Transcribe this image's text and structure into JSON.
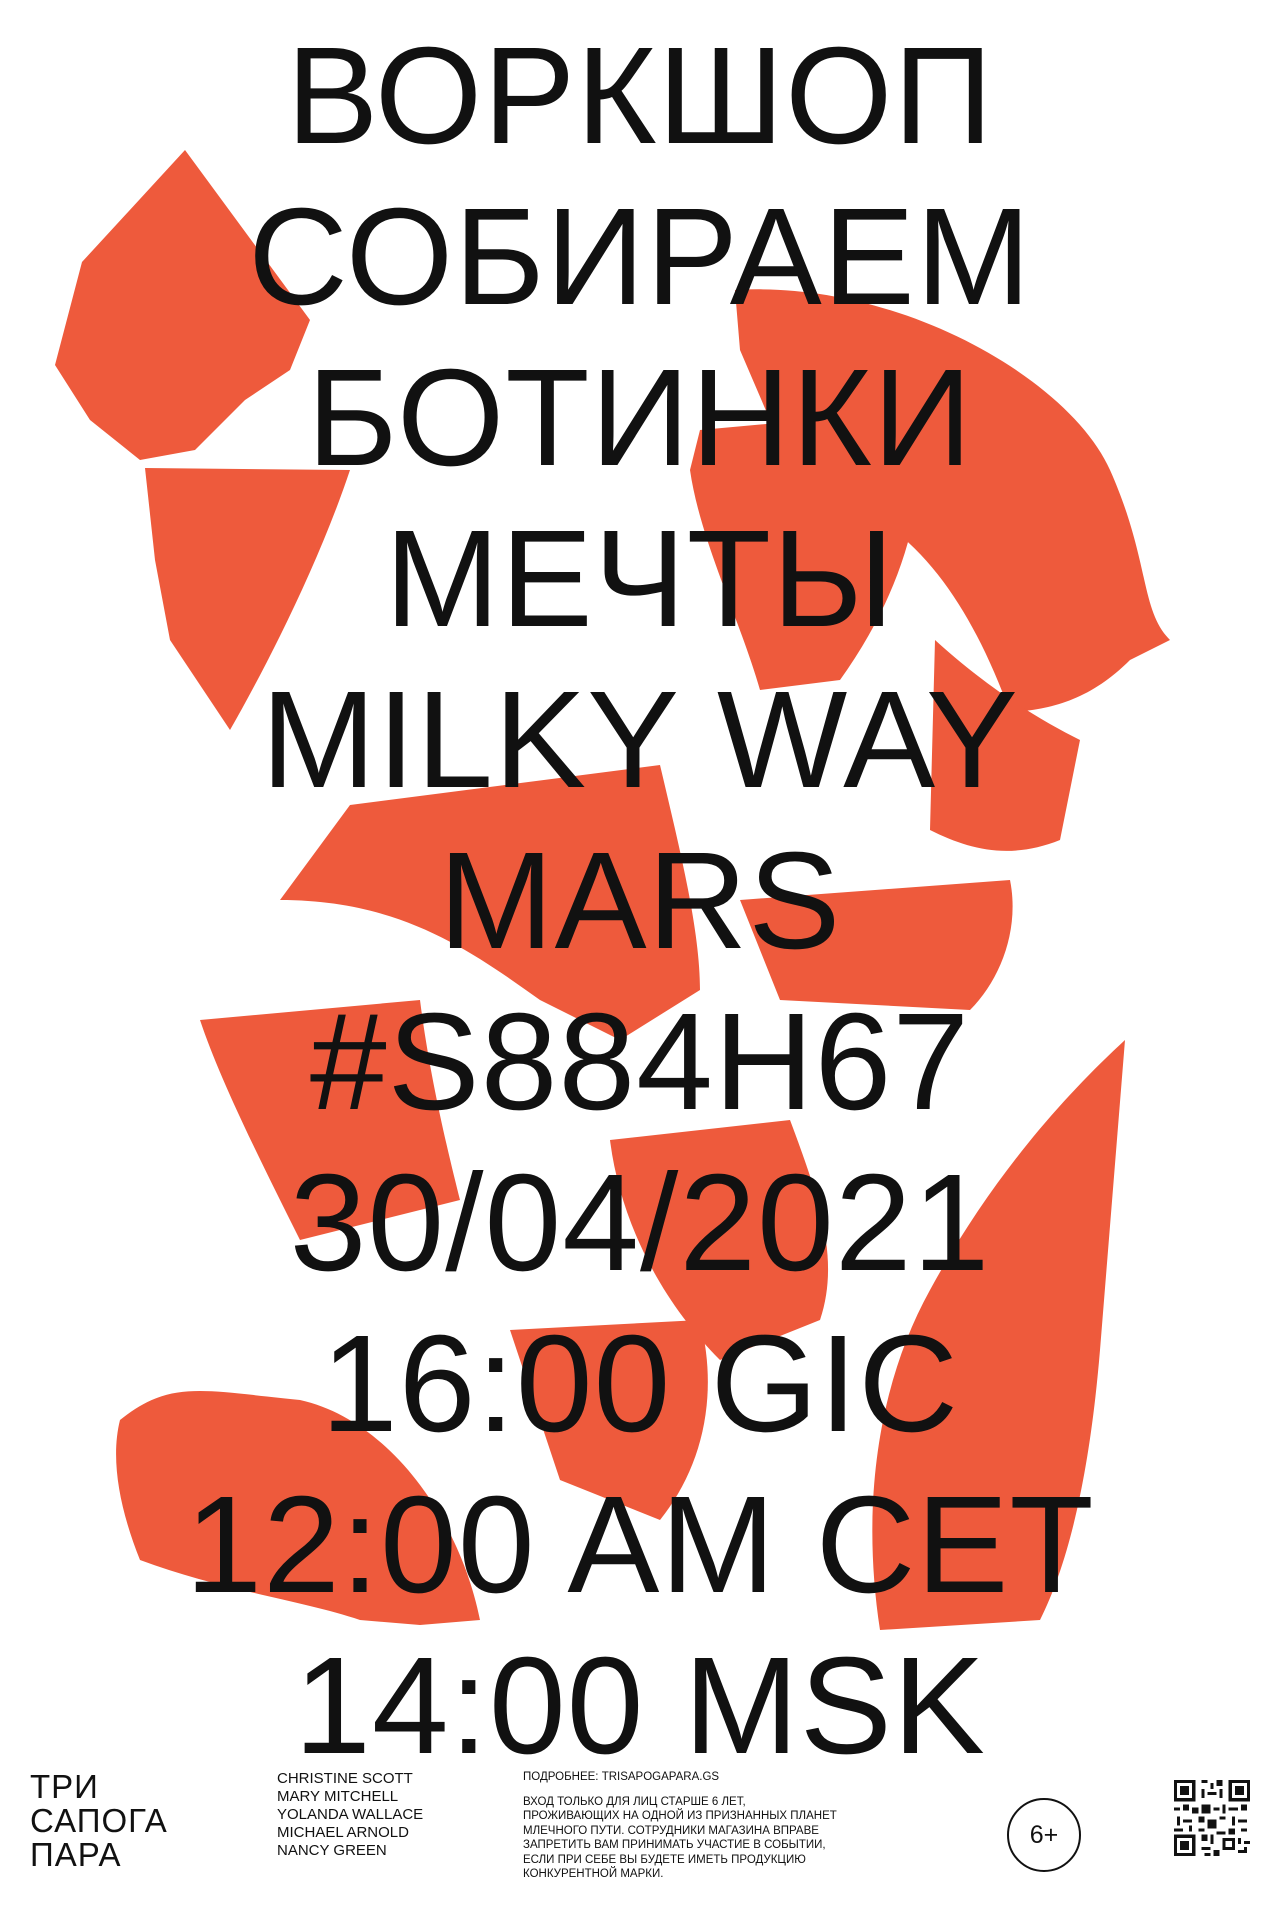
{
  "poster": {
    "accent_color": "#ee5a3c",
    "headline_lines": [
      "ВОРКШОП",
      "СОБИРАЕМ",
      "БОТИНКИ",
      "МЕЧТЫ",
      "MILKY WAY",
      "MARS",
      "#S884H67",
      "30/04/2021",
      "16:00 GIC",
      "12:00 AM CET",
      "14:00 MSK"
    ]
  },
  "footer": {
    "logo_lines": [
      "ТРИ",
      "САПОГА",
      "ПАРА"
    ],
    "names": [
      "CHRISTINE SCOTT",
      "MARY MITCHELL",
      "YOLANDA WALLACE",
      "MICHAEL ARNOLD",
      "NANCY GREEN"
    ],
    "more_info": "ПОДРОБНЕЕ: TRISAPOGAPARA.GS",
    "disclaimer": "ВХОД ТОЛЬКО ДЛЯ ЛИЦ СТАРШЕ 6 ЛЕТ, ПРОЖИВАЮЩИХ НА ОДНОЙ ИЗ ПРИЗНАННЫХ ПЛАНЕТ МЛЕЧНОГО ПУТИ. СОТРУДНИКИ МАГАЗИНА ВПРАВЕ ЗАПРЕТИТЬ ВАМ ПРИНИМАТЬ УЧАСТИЕ В СОБЫТИИ, ЕСЛИ ПРИ СЕБЕ ВЫ БУДЕТЕ ИМЕТЬ ПРОДУКЦИЮ КОНКУРЕНТНОЙ МАРКИ.",
    "age_rating": "6+",
    "qr_icon": "qr-code-icon"
  }
}
